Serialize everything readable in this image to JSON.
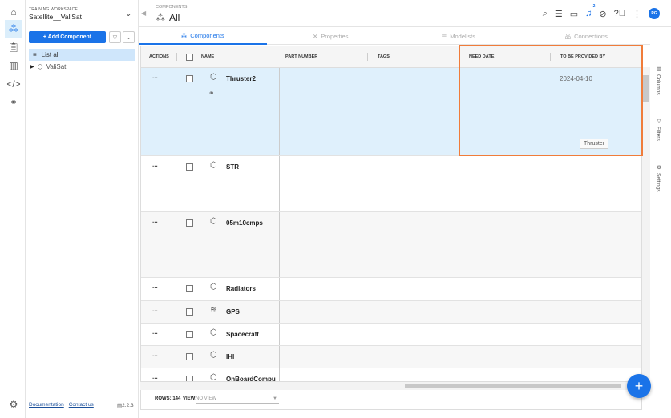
{
  "workspace": {
    "label": "TRAINING WORKSPACE",
    "name": "Satellite__ValiSat"
  },
  "sidebar": {
    "add_label": "+ Add Component",
    "list_all": "List all",
    "tree_root": "ValiSat",
    "doc_link": "Documentation",
    "contact_link": "Contact us",
    "version": "2.2.3"
  },
  "header": {
    "crumb": "COMPONENTS",
    "title": "All",
    "notification_count": "2",
    "avatar": "PG"
  },
  "tabs": [
    {
      "label": "Components"
    },
    {
      "label": "Properties"
    },
    {
      "label": "Modelists"
    },
    {
      "label": "Connections"
    }
  ],
  "columns": {
    "actions": "ACTIONS",
    "name": "NAME",
    "part_number": "PART NUMBER",
    "tags": "TAGS",
    "need_date": "NEED DATE",
    "provided_by": "TO BE PROVIDED BY"
  },
  "rows": [
    {
      "name": "Thruster2",
      "provided_by": "2024-04-10",
      "dots": "..."
    },
    {
      "name": "STR",
      "dots": "..."
    },
    {
      "name": "05m10cmps",
      "dots": "..."
    },
    {
      "name": "Radiators",
      "dots": "..."
    },
    {
      "name": "GPS",
      "dots": "..."
    },
    {
      "name": "Spacecraft",
      "dots": "..."
    },
    {
      "name": "IHI",
      "dots": "..."
    },
    {
      "name": "OnBoardCompu",
      "dots": "..."
    }
  ],
  "tooltip": "Thruster",
  "footer": {
    "rows_label": "ROWS: 144",
    "view_label": "VIEW:",
    "view_value": "NO VIEW"
  },
  "right_panel": {
    "columns": "Columns",
    "filters": "Filters",
    "settings": "Settings"
  },
  "colors": {
    "accent": "#1a73e8",
    "highlight": "#f07c3a",
    "selected_row": "#dff0fc"
  }
}
